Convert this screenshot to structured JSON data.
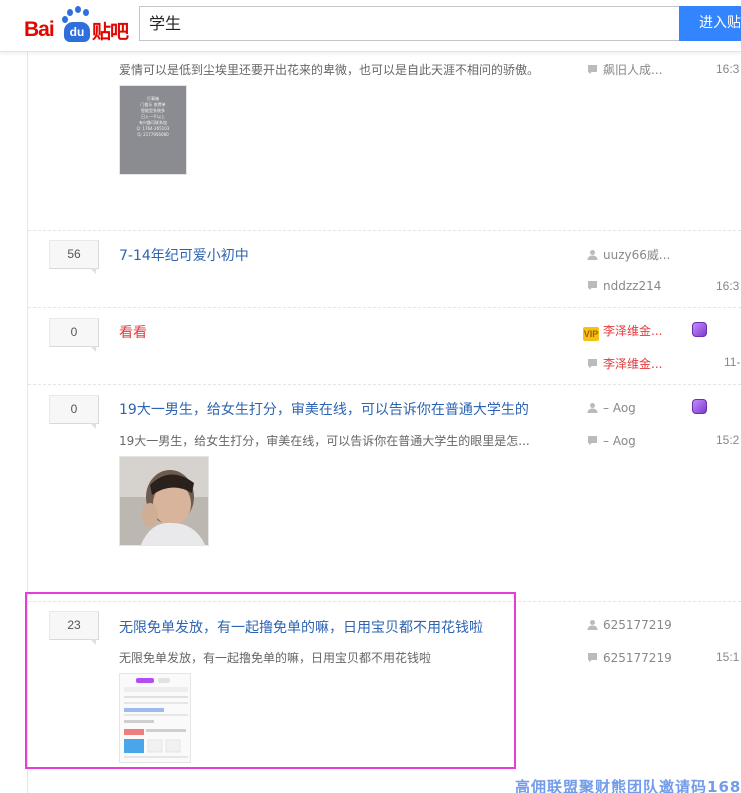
{
  "header": {
    "logo_bai": "Bai",
    "logo_du": "du",
    "logo_tieba": "贴吧",
    "search_value": "学生",
    "search_button": "进入贴吧"
  },
  "threads": [
    {
      "reply_count": "",
      "title": "",
      "abstract": "爱情可以是低到尘埃里还要开出花来的卑微，也可以是自此天涯不相问的骄傲。",
      "author": "",
      "last_reply_user": "飙旧人成...",
      "time": "16:3",
      "thumb_text": [
        "打事箱",
        "门槛乐 收费单",
        "智能型系统多",
        "日入一千以上",
        "有兴趣可联系加",
        "Q: 1764-265103",
        "Q: 2177956080"
      ]
    },
    {
      "reply_count": "56",
      "title": "7-14年纪可爱小初中",
      "abstract": "",
      "author": "uuzy66威...",
      "last_reply_user": "nddzz214",
      "time": "16:3"
    },
    {
      "reply_count": "0",
      "title": "看看",
      "title_red": true,
      "abstract": "",
      "author": "李泽维金...",
      "last_reply_user": "李泽维金...",
      "time": "11-",
      "author_vip": "VIP"
    },
    {
      "reply_count": "0",
      "title": "19大一男生，给女生打分，审美在线，可以告诉你在普通大学生的",
      "abstract": "19大一男生，给女生打分，审美在线，可以告诉你在普通大学生的眼里是怎...",
      "author": "– Aog",
      "last_reply_user": "– Aog",
      "time": "15:2"
    },
    {
      "reply_count": "23",
      "title": "无限免单发放，有一起撸免单的嘛，日用宝贝都不用花钱啦",
      "abstract": "无限免单发放，有一起撸免单的嘛，日用宝贝都不用花钱啦",
      "author": "625177219",
      "last_reply_user": "625177219",
      "time": "15:1"
    }
  ],
  "watermark": "高佣联盟聚财熊团队邀请码1688",
  "colors": {
    "link_blue": "#2d64b3",
    "red": "#e4393c",
    "search_button": "#3385ff",
    "highlight": "#e83cd9"
  }
}
